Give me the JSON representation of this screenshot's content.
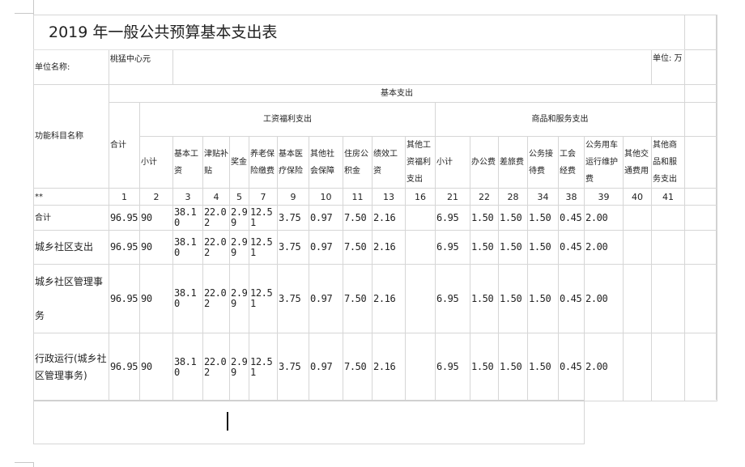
{
  "doc": {
    "title": "2019 年一般公共预算基本支出表",
    "unit_name_label": "单位名称:",
    "unit_name_value": "桃猛中心元",
    "unit_label": "单位: 万"
  },
  "headers": {
    "func_name": "功能科目名称",
    "basic": "基本支出",
    "wages_group": "工资福利支出",
    "goods_group": "商品和服务支出",
    "total": "合计",
    "subtotal": "小计",
    "basic_wage": "基本工资",
    "allowance": "津贴补贴",
    "bonus": "奖金",
    "pension": "养老保险缴费",
    "medical": "基本医疗保险",
    "other_social": "其他社会保障",
    "housing": "住房公积金",
    "performance": "绩效工资",
    "other_wages": "其他工资福利支出",
    "subtotal2": "小计",
    "office": "办公费",
    "travel": "差旅费",
    "reception": "公务接待费",
    "union": "工会经费",
    "vehicle": "公务用车运行维护费",
    "other_transport": "其他交通费用",
    "other_goods": "其他商品和服务支出"
  },
  "index_row": [
    "**",
    "1",
    "2",
    "3",
    "4",
    "5",
    "7",
    "9",
    "10",
    "11",
    "13",
    "16",
    "21",
    "22",
    "28",
    "34",
    "38",
    "39",
    "40",
    "41"
  ],
  "rows": [
    {
      "name": "合计",
      "values": [
        "96.95",
        "90",
        "38.10",
        "22.02",
        "2.99",
        "12.51",
        "3.75",
        "0.97",
        "7.50",
        "2.16",
        "",
        "6.95",
        "1.50",
        "1.50",
        "1.50",
        "0.45",
        "2.00",
        "",
        ""
      ]
    },
    {
      "name": "城乡社区支出",
      "values": [
        "96.95",
        "90",
        "38.10",
        "22.02",
        "2.99",
        "12.51",
        "3.75",
        "0.97",
        "7.50",
        "2.16",
        "",
        "6.95",
        "1.50",
        "1.50",
        "1.50",
        "0.45",
        "2.00",
        "",
        ""
      ]
    },
    {
      "name": "城乡社区管理事务",
      "values": [
        "96.95",
        "90",
        "38.10",
        "22.02",
        "2.99",
        "12.51",
        "3.75",
        "0.97",
        "7.50",
        "2.16",
        "",
        "6.95",
        "1.50",
        "1.50",
        "1.50",
        "0.45",
        "2.00",
        "",
        ""
      ]
    },
    {
      "name": "行政运行(城乡社区管理事务)",
      "values": [
        "96.95",
        "90",
        "38.10",
        "22.02",
        "2.99",
        "12.51",
        "3.75",
        "0.97",
        "7.50",
        "2.16",
        "",
        "6.95",
        "1.50",
        "1.50",
        "1.50",
        "0.45",
        "2.00",
        "",
        ""
      ]
    }
  ]
}
